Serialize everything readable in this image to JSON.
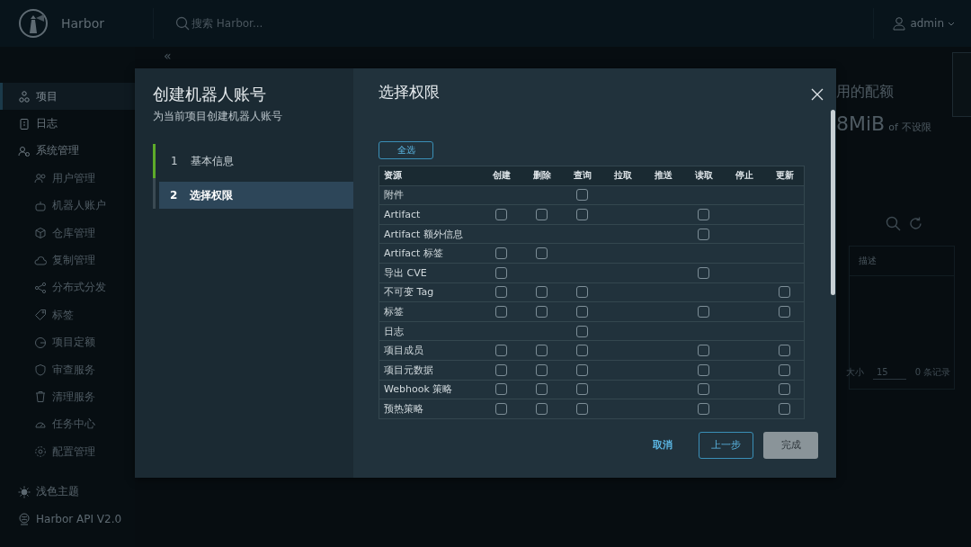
{
  "header": {
    "logo_text": "Harbor",
    "search_placeholder": "搜索 Harbor...",
    "user": "admin"
  },
  "sidebar": {
    "items": [
      {
        "label": "项目",
        "selected": true
      },
      {
        "label": "日志",
        "selected": false
      },
      {
        "label": "系统管理",
        "selected": false,
        "children": [
          {
            "label": "用户管理",
            "selected": false
          },
          {
            "label": "机器人账户",
            "selected": false
          },
          {
            "label": "仓库管理",
            "selected": false
          },
          {
            "label": "复制管理",
            "selected": false
          },
          {
            "label": "分布式分发",
            "selected": false
          },
          {
            "label": "标签",
            "selected": false
          },
          {
            "label": "项目定额",
            "selected": false
          },
          {
            "label": "审查服务",
            "selected": false
          },
          {
            "label": "清理服务",
            "selected": false
          },
          {
            "label": "任务中心",
            "selected": false
          },
          {
            "label": "配置管理",
            "selected": false
          }
        ]
      }
    ],
    "footer": [
      "浅色主题",
      "Harbor API V2.0"
    ]
  },
  "background": {
    "collapse": "«",
    "quota_title": "用的配额",
    "quota_value": "8MiB",
    "quota_of": "of",
    "quota_limit": "不设限",
    "table_column": "描述",
    "page_size_label": "大小",
    "page_size": "15",
    "record_count": "0 条记录"
  },
  "modal": {
    "title": "创建机器人账号",
    "subtitle": "为当前项目创建机器人账号",
    "steps": [
      {
        "number": "1",
        "label": "基本信息",
        "selected": false,
        "completed": true
      },
      {
        "number": "2",
        "label": "选择权限",
        "selected": true,
        "completed": false
      }
    ],
    "heading": "选择权限",
    "select_all": "全选",
    "columns": [
      "资源",
      "创建",
      "删除",
      "查询",
      "拉取",
      "推送",
      "读取",
      "停止",
      "更新"
    ],
    "rows": [
      {
        "resource": "附件",
        "cells": [
          null,
          null,
          {
            "checked": false
          },
          null,
          null,
          null,
          null,
          null
        ]
      },
      {
        "resource": "Artifact",
        "cells": [
          {
            "checked": false
          },
          {
            "checked": false
          },
          {
            "checked": false
          },
          null,
          null,
          {
            "checked": false
          },
          null,
          null
        ]
      },
      {
        "resource": "Artifact 额外信息",
        "cells": [
          null,
          null,
          null,
          null,
          null,
          {
            "checked": false
          },
          null,
          null
        ]
      },
      {
        "resource": "Artifact 标签",
        "cells": [
          {
            "checked": false
          },
          {
            "checked": false
          },
          null,
          null,
          null,
          null,
          null,
          null
        ]
      },
      {
        "resource": "导出 CVE",
        "cells": [
          {
            "checked": false
          },
          null,
          null,
          null,
          null,
          {
            "checked": false
          },
          null,
          null
        ]
      },
      {
        "resource": "不可变 Tag",
        "cells": [
          {
            "checked": false
          },
          {
            "checked": false
          },
          {
            "checked": false
          },
          null,
          null,
          null,
          null,
          {
            "checked": false
          }
        ]
      },
      {
        "resource": "标签",
        "cells": [
          {
            "checked": false
          },
          {
            "checked": false
          },
          {
            "checked": false
          },
          null,
          null,
          {
            "checked": false
          },
          null,
          {
            "checked": false
          }
        ]
      },
      {
        "resource": "日志",
        "cells": [
          null,
          null,
          {
            "checked": false
          },
          null,
          null,
          null,
          null,
          null
        ]
      },
      {
        "resource": "项目成员",
        "cells": [
          {
            "checked": false
          },
          {
            "checked": false
          },
          {
            "checked": false
          },
          null,
          null,
          {
            "checked": false
          },
          null,
          {
            "checked": false
          }
        ]
      },
      {
        "resource": "项目元数据",
        "cells": [
          {
            "checked": false
          },
          {
            "checked": false
          },
          {
            "checked": false
          },
          null,
          null,
          {
            "checked": false
          },
          null,
          {
            "checked": false
          }
        ]
      },
      {
        "resource": "Webhook 策略",
        "cells": [
          {
            "checked": false
          },
          {
            "checked": false
          },
          {
            "checked": false
          },
          null,
          null,
          {
            "checked": false
          },
          null,
          {
            "checked": false
          }
        ]
      },
      {
        "resource": "预热策略",
        "cells": [
          {
            "checked": false
          },
          {
            "checked": false
          },
          {
            "checked": false
          },
          null,
          null,
          {
            "checked": false
          },
          null,
          {
            "checked": false
          }
        ]
      }
    ],
    "buttons": [
      {
        "label": "取消",
        "kind": "link",
        "disabled": false
      },
      {
        "label": "上一步",
        "kind": "outline",
        "disabled": false
      },
      {
        "label": "完成",
        "kind": "primary",
        "disabled": true
      }
    ]
  }
}
